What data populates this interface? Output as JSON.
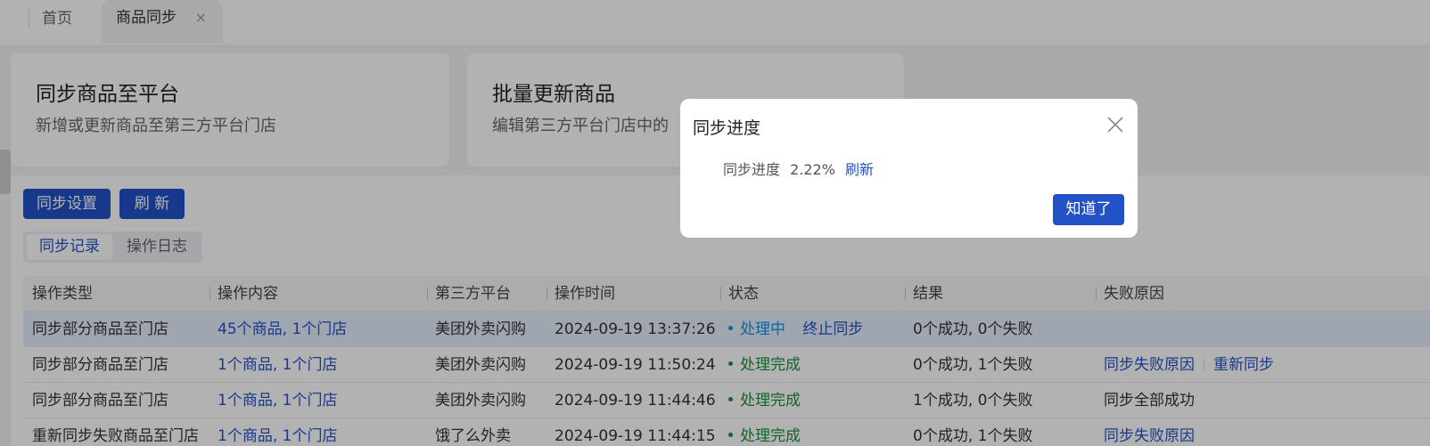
{
  "tabs": {
    "home": "首页",
    "active": "商品同步",
    "close_glyph": "×"
  },
  "cards": [
    {
      "title": "同步商品至平台",
      "subtitle": "新增或更新商品至第三方平台门店"
    },
    {
      "title": "批量更新商品",
      "subtitle": "编辑第三方平台门店中的"
    }
  ],
  "toolbar": {
    "sync_settings": "同步设置",
    "refresh": "刷 新"
  },
  "segmented": {
    "records": "同步记录",
    "logs": "操作日志"
  },
  "table": {
    "columns": [
      "操作类型",
      "操作内容",
      "第三方平台",
      "操作时间",
      "状态",
      "结果",
      "失败原因"
    ],
    "rows": [
      {
        "type": "同步部分商品至门店",
        "content": "45个商品, 1个门店",
        "platform": "美团外卖闪购",
        "time": "2024-09-19 13:37:26",
        "status": "处理中",
        "status_kind": "processing",
        "status_action": "终止同步",
        "result": "0个成功, 0个失败",
        "fail_reason": "",
        "fail_links": []
      },
      {
        "type": "同步部分商品至门店",
        "content": "1个商品, 1个门店",
        "platform": "美团外卖闪购",
        "time": "2024-09-19 11:50:24",
        "status": "处理完成",
        "status_kind": "done",
        "status_action": "",
        "result": "0个成功, 1个失败",
        "fail_reason": "",
        "fail_links": [
          "同步失败原因",
          "重新同步"
        ]
      },
      {
        "type": "同步部分商品至门店",
        "content": "1个商品, 1个门店",
        "platform": "美团外卖闪购",
        "time": "2024-09-19 11:44:46",
        "status": "处理完成",
        "status_kind": "done",
        "status_action": "",
        "result": "1个成功, 0个失败",
        "fail_reason": "同步全部成功",
        "fail_links": []
      },
      {
        "type": "重新同步失败商品至门店",
        "content": "1个商品, 1个门店",
        "platform": "饿了么外卖",
        "time": "2024-09-19 11:44:15",
        "status": "处理完成",
        "status_kind": "done",
        "status_action": "",
        "result": "0个成功, 1个失败",
        "fail_reason": "",
        "fail_links": [
          "同步失败原因"
        ]
      }
    ]
  },
  "modal": {
    "title": "同步进度",
    "progress_label": "同步进度",
    "progress_value": "2.22%",
    "progress_fraction": 0.0222,
    "refresh_link": "刷新",
    "ok_button": "知道了"
  },
  "colors": {
    "primary": "#2352c7",
    "processing": "#1a8fd9",
    "done": "#1e8e3e"
  },
  "icons": [
    "close-icon",
    "modal-close-icon"
  ]
}
